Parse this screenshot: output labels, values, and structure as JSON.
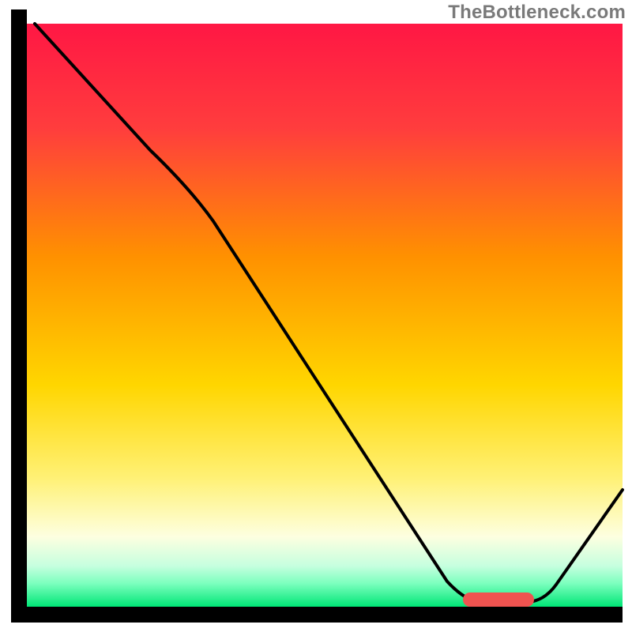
{
  "watermark": "TheBottleneck.com",
  "chart_data": {
    "type": "line",
    "title": "",
    "xlabel": "",
    "ylabel": "",
    "xlim": [
      0,
      100
    ],
    "ylim": [
      0,
      100
    ],
    "grid": false,
    "legend": false,
    "colors": {
      "gradient_top": "#ff1744",
      "gradient_mid1": "#ff9100",
      "gradient_mid2": "#ffee00",
      "gradient_low": "#fff59d",
      "gradient_bottom": "#00e676",
      "axis": "#000000",
      "line": "#000000",
      "marker": "#ef5350"
    },
    "axis_thickness_px": 20,
    "background_bands_pct_from_top": [
      {
        "stop": 0,
        "color": "#ff1744"
      },
      {
        "stop": 40,
        "color": "#ff9100"
      },
      {
        "stop": 65,
        "color": "#ffee00"
      },
      {
        "stop": 80,
        "color": "#fff59d"
      },
      {
        "stop": 95,
        "color": "#7cffbe"
      },
      {
        "stop": 100,
        "color": "#00e676"
      }
    ],
    "series": [
      {
        "name": "bottleneck-curve",
        "x": [
          2,
          20,
          32,
          72,
          78,
          85,
          100
        ],
        "y": [
          100,
          78,
          70,
          4,
          1,
          1,
          20
        ],
        "comment": "y is percentage from bottom of plot area; curve starts at top-left, bends near x≈30, descends to a flat minimum around x≈75–85, then rises to the right edge."
      }
    ],
    "marker": {
      "name": "optimal-range",
      "x_start": 75,
      "x_end": 85,
      "y": 1,
      "shape": "rounded-bar"
    }
  }
}
